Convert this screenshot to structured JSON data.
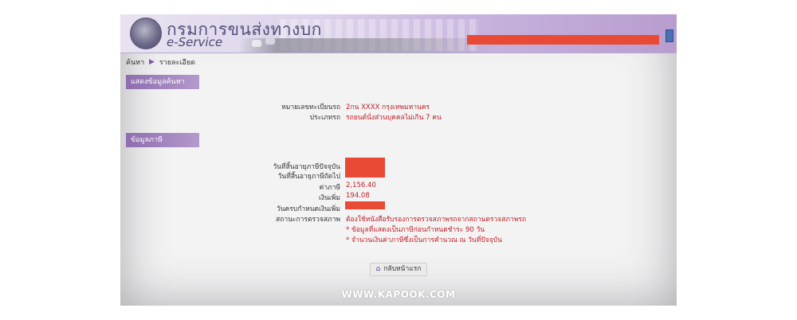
{
  "header": {
    "site_title": "กรมการขนส่งทางบก",
    "site_subtitle": "e-Service",
    "user_redacted": true,
    "colors": {
      "banner": "#c8b5de",
      "redaction": "#e94a35"
    },
    "icons": {
      "logo": "dlt-seal-logo",
      "exit": "exit-icon"
    }
  },
  "breadcrumb": {
    "item1": "ค้นหา",
    "separator": "▶",
    "item2": "รายละเอียด"
  },
  "sections": {
    "search_info": "แสดงข้อมูลค้นหา",
    "tax_info": "ข้อมูลภาษี"
  },
  "search_info": {
    "plate_label": "หมายเลขทะเบียนรถ",
    "plate_value": "2กน XXXX  กรุงเทพมหานคร",
    "type_label": "ประเภทรถ",
    "type_value": "รถยนต์นั่งส่วนบุคคลไม่เกิน 7 คน"
  },
  "tax_info": {
    "current_expiry_label": "วันที่สิ้นอายุภาษีปัจจุบัน",
    "next_expiry_label": "วันที่สิ้นอายุภาษีถัดไป",
    "tax_label": "ค่าภาษี",
    "tax_value": "2,156.40",
    "surcharge_label": "เงินเพิ่ม",
    "surcharge_value": "194.08",
    "surcharge_due_label": "วันครบกำหนดเงินเพิ่ม",
    "inspection_label": "สถานะการตรวจสภาพ",
    "inspection_value": "ต้องใช้หนังสือรับรองการตรวจสภาพรถจากสถานตรวจสภาพรถ",
    "note1": "* ข้อมูลที่แสดงเป็นภาษีก่อนกำหนดชำระ 90 วัน",
    "note2": "* จำนวนเงินค่าภาษีซึ่งเป็นการคำนวณ ณ วันที่ปัจจุบัน"
  },
  "back_button": {
    "label": "กลับหน้าแรก",
    "icon": "home-icon"
  },
  "watermark": "WWW.KAPOOK.COM"
}
